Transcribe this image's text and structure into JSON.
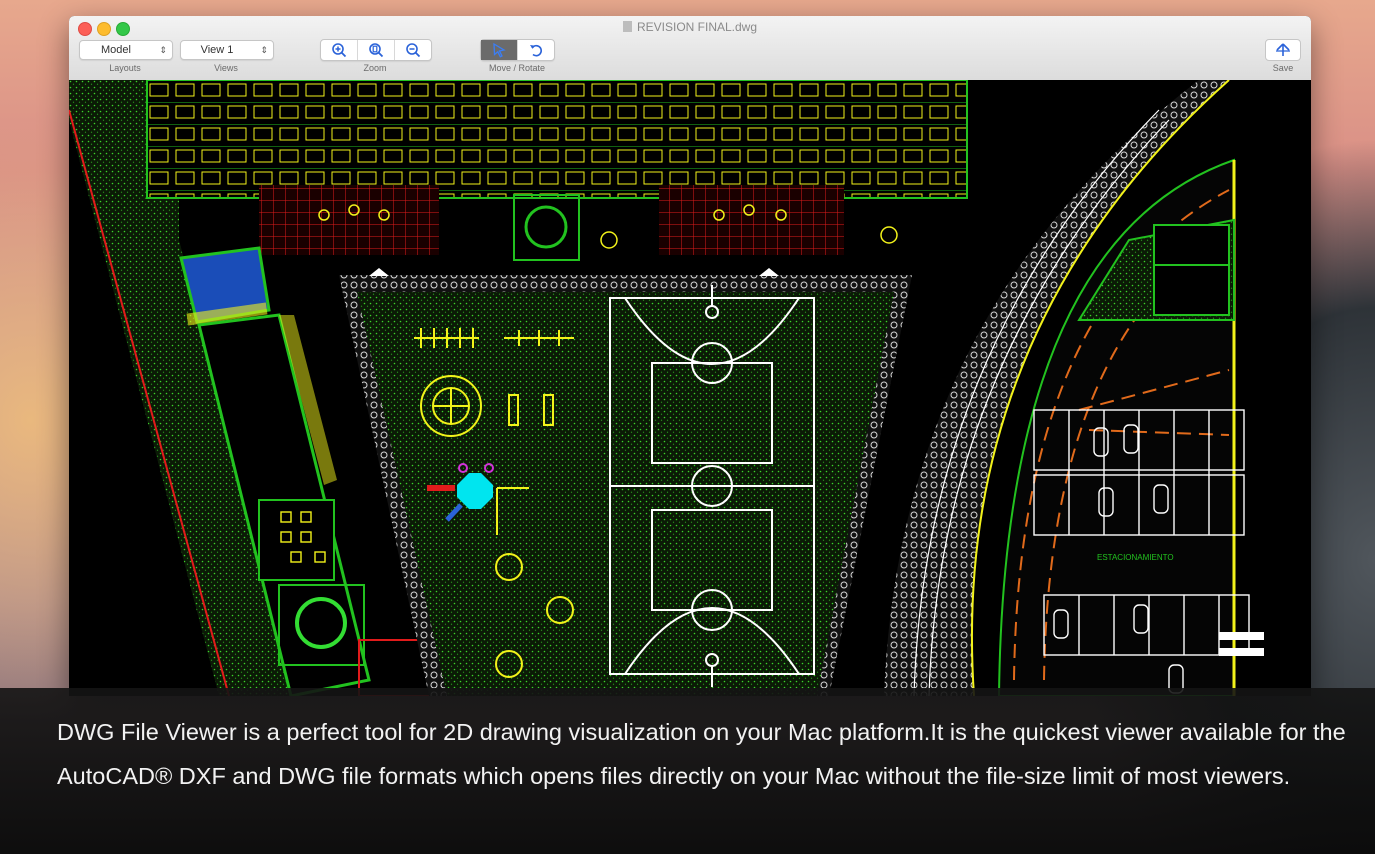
{
  "window": {
    "title": "REVISION FINAL.dwg"
  },
  "toolbar": {
    "layouts": {
      "value": "Model",
      "label": "Layouts"
    },
    "views": {
      "value": "View 1",
      "label": "Views"
    },
    "zoom": {
      "label": "Zoom",
      "icons": [
        "zoom-in-icon",
        "zoom-fit-icon",
        "zoom-out-icon"
      ]
    },
    "move_rotate": {
      "label": "Move / Rotate",
      "icons": [
        "select-arrow-icon",
        "rotate-icon"
      ]
    },
    "save": {
      "label": "Save",
      "icon": "upload-arrow-icon"
    }
  },
  "drawing": {
    "annotations": [
      "ESTACIONAMIENTO"
    ]
  },
  "caption": {
    "text": "DWG File Viewer is a perfect tool for 2D drawing visualization on your Mac platform.It is the quickest viewer available for the AutoCAD® DXF and DWG file formats which opens files directly on your Mac without the file-size limit of most viewers."
  },
  "colors": {
    "accent_blue": "#2b63d9",
    "cad_green": "#22c21f",
    "cad_yellow": "#f2f21a",
    "cad_red": "#e11b1b",
    "cad_white": "#ffffff",
    "cad_background": "#000000"
  }
}
